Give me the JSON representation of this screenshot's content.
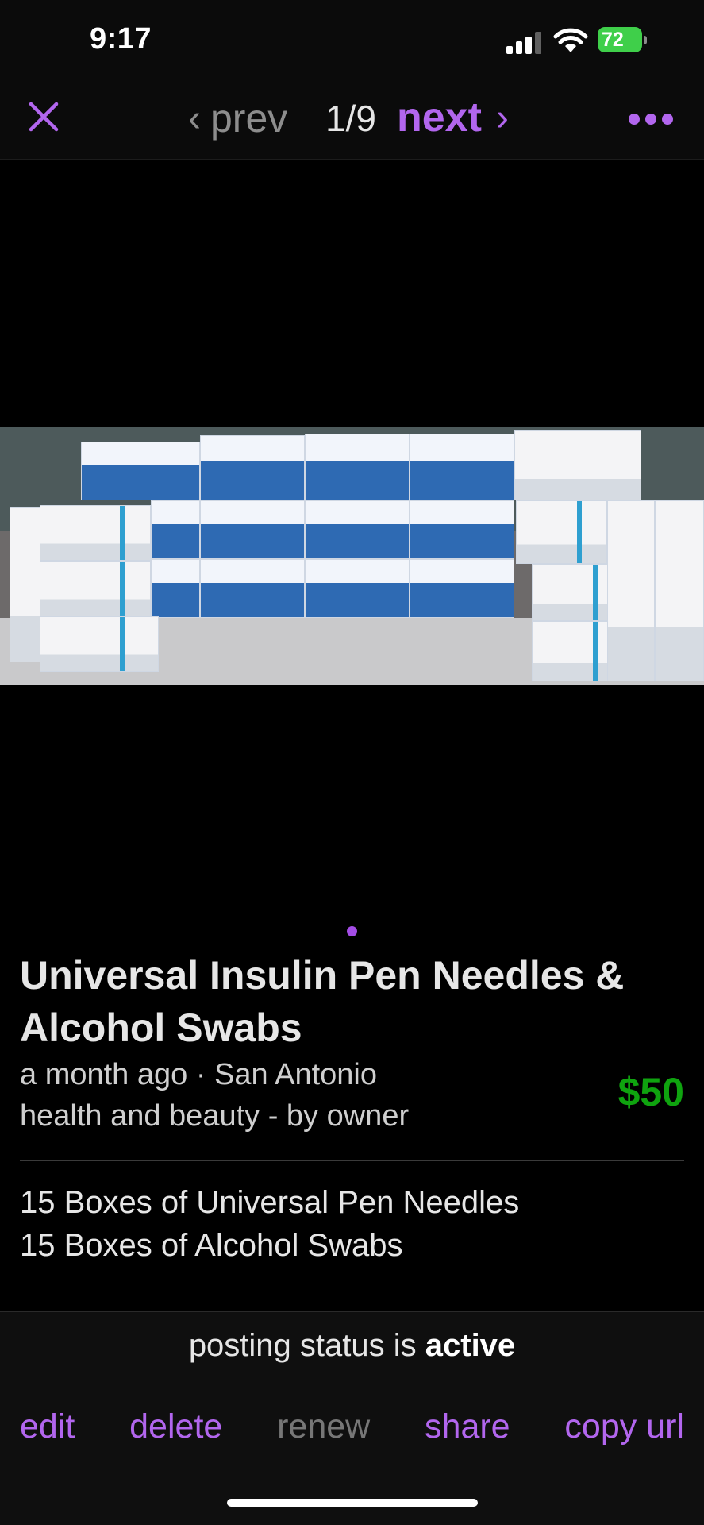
{
  "status_bar": {
    "time": "9:17",
    "battery": "72"
  },
  "nav": {
    "prev_label": "prev",
    "counter": "1/9",
    "next_label": "next"
  },
  "listing": {
    "title": "Universal Insulin Pen Needles & Alcohol Swabs",
    "meta_line1": "a month ago · San Antonio",
    "meta_line2": "health and beauty - by owner",
    "price": "$50",
    "body_line1": "15 Boxes of Universal Pen Needles",
    "body_line2": "15 Boxes of Alcohol Swabs"
  },
  "footer": {
    "status_prefix": "posting status is",
    "status_value": "active",
    "actions": {
      "edit": "edit",
      "delete": "delete",
      "renew": "renew",
      "share": "share",
      "copy_url": "copy url"
    }
  },
  "colors": {
    "accent": "#b266ee",
    "price": "#0fa30f",
    "disabled": "#777777"
  },
  "icons": [
    "close-icon",
    "chevron-left-icon",
    "chevron-right-icon",
    "more-icon",
    "signal-icon",
    "wifi-icon",
    "battery-icon"
  ]
}
